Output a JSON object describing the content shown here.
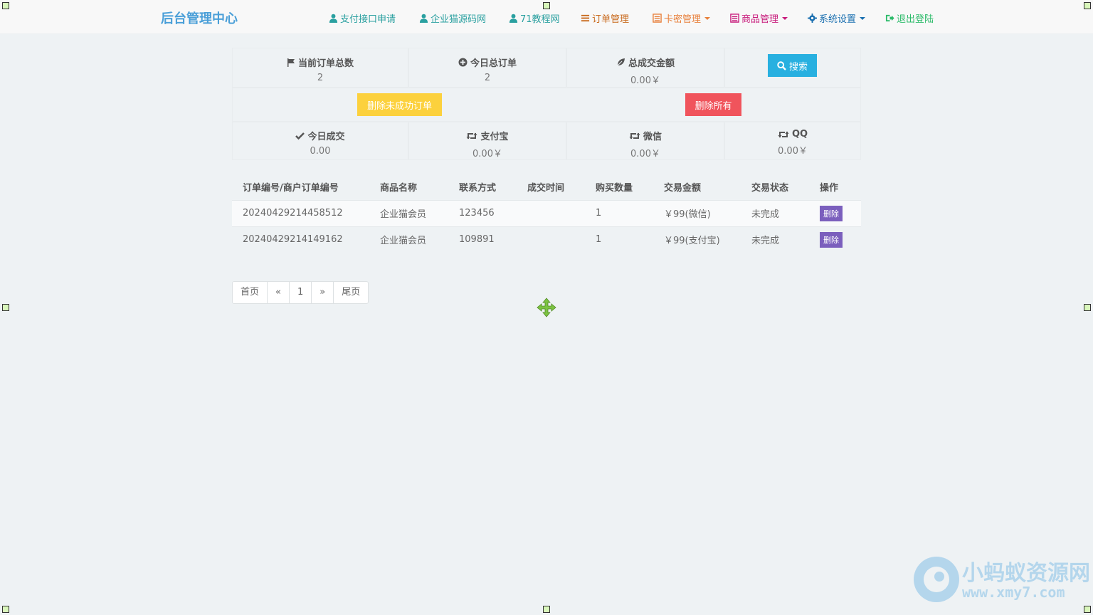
{
  "brand": "后台管理中心",
  "nav": [
    {
      "label": "支付接口申请",
      "icon": "user-icon",
      "color": "#2aa0a0"
    },
    {
      "label": "企业猫源码网",
      "icon": "user-icon",
      "color": "#2aa0a0"
    },
    {
      "label": "71教程网",
      "icon": "user-icon",
      "color": "#2aa0a0"
    },
    {
      "label": "订单管理",
      "icon": "list-icon",
      "color": "#c8691c"
    },
    {
      "label": "卡密管理",
      "icon": "list-alt-icon",
      "color": "#e8803c",
      "dropdown": true
    },
    {
      "label": "商品管理",
      "icon": "list-alt-icon",
      "color": "#c81c7c",
      "dropdown": true
    },
    {
      "label": "系统设置",
      "icon": "gear-icon",
      "color": "#1a6fb0",
      "dropdown": true
    },
    {
      "label": "退出登陆",
      "icon": "logout-icon",
      "color": "#2dbb6a"
    }
  ],
  "stats": {
    "total_orders": {
      "label": "当前订单总数",
      "value": "2",
      "icon": "flag-icon"
    },
    "today_orders": {
      "label": "今日总订单",
      "value": "2",
      "icon": "plus-circle-icon"
    },
    "total_amount": {
      "label": "总成交金额",
      "value": "0.00￥",
      "icon": "leaf-icon"
    },
    "today_deal": {
      "label": "今日成交",
      "value": "0.00",
      "icon": "check-icon"
    },
    "alipay": {
      "label": "支付宝",
      "value": "0.00￥",
      "icon": "retweet-icon"
    },
    "wechat": {
      "label": "微信",
      "value": "0.00￥",
      "icon": "retweet-icon"
    },
    "qq": {
      "label": "QQ",
      "value": "0.00￥",
      "icon": "retweet-icon"
    }
  },
  "buttons": {
    "search": "搜索",
    "delete_unfinished": "删除未成功订单",
    "delete_all": "删除所有"
  },
  "table": {
    "headers": [
      "订单编号/商户订单编号",
      "商品名称",
      "联系方式",
      "成交时间",
      "购买数量",
      "交易金额",
      "交易状态",
      "操作"
    ],
    "rows": [
      {
        "order_no": "20240429214458512",
        "product": "企业猫会员",
        "contact": "123456",
        "time": "",
        "qty": "1",
        "amount": "￥99(微信)",
        "status": "未完成",
        "action": "删除"
      },
      {
        "order_no": "20240429214149162",
        "product": "企业猫会员",
        "contact": "109891",
        "time": "",
        "qty": "1",
        "amount": "￥99(支付宝)",
        "status": "未完成",
        "action": "删除"
      }
    ]
  },
  "pagination": [
    "首页",
    "«",
    "1",
    "»",
    "尾页"
  ],
  "watermark": {
    "line1": "小蚂蚁资源网",
    "line2": "www.xmy7.com"
  }
}
